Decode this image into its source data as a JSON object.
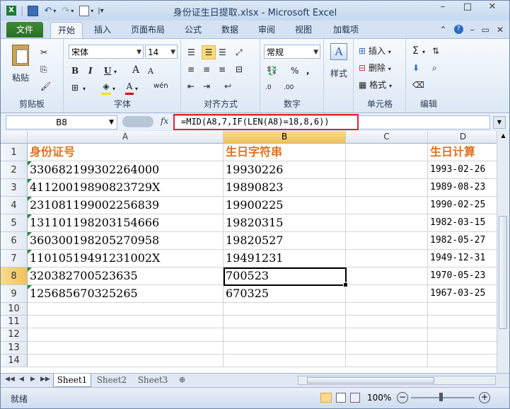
{
  "window": {
    "title": "身份证生日提取.xlsx - Microsoft Excel",
    "controls": [
      "–",
      "□",
      "✕"
    ]
  },
  "ribbon_tabs": [
    "文件",
    "开始",
    "插入",
    "页面布局",
    "公式",
    "数据",
    "审阅",
    "视图",
    "加载项"
  ],
  "ribbon": {
    "clipboard": {
      "paste": "粘贴",
      "label": "剪贴板"
    },
    "font": {
      "name": "宋体",
      "size": "14",
      "bold": "B",
      "italic": "I",
      "underline": "U",
      "grow": "A",
      "shrink": "A",
      "font_color": "A",
      "wen": "wén",
      "label": "字体"
    },
    "alignment": {
      "label": "对齐方式"
    },
    "number": {
      "format": "常规",
      "percent": "%",
      "comma": ",",
      "inc": ".0",
      "label": "数字"
    },
    "styles": {
      "button": "样式"
    },
    "cells": {
      "insert": "插入",
      "delete": "删除",
      "format": "格式",
      "label": "单元格"
    },
    "editing": {
      "sum": "Σ",
      "label": "编辑"
    }
  },
  "formula_bar": {
    "name_box": "B8",
    "fx": "fx",
    "formula": "=MID(A8,7,IF(LEN(A8)=18,8,6))"
  },
  "columns": [
    "A",
    "B",
    "C",
    "D"
  ],
  "rows": [
    "1",
    "2",
    "3",
    "4",
    "5",
    "6",
    "7",
    "8",
    "9",
    "10",
    "11",
    "12",
    "13",
    "14"
  ],
  "table": {
    "headers": [
      "身份证号",
      "生日字符串",
      "",
      "生日计算"
    ],
    "rows": [
      [
        "330682199302264000",
        "19930226",
        "",
        "1993-02-26"
      ],
      [
        "41120019890823729X",
        "19890823",
        "",
        "1989-08-23"
      ],
      [
        "231081199002256839",
        "19900225",
        "",
        "1990-02-25"
      ],
      [
        "131101198203154666",
        "19820315",
        "",
        "1982-03-15"
      ],
      [
        "360300198205270958",
        "19820527",
        "",
        "1982-05-27"
      ],
      [
        "11010519491231002X",
        "19491231",
        "",
        "1949-12-31"
      ],
      [
        "320382700523635",
        "700523",
        "",
        "1970-05-23"
      ],
      [
        "125685670325265",
        "670325",
        "",
        "1967-03-25"
      ]
    ]
  },
  "sheets": [
    "Sheet1",
    "Sheet2",
    "Sheet3"
  ],
  "status": {
    "ready": "就绪",
    "zoom": "100%"
  }
}
